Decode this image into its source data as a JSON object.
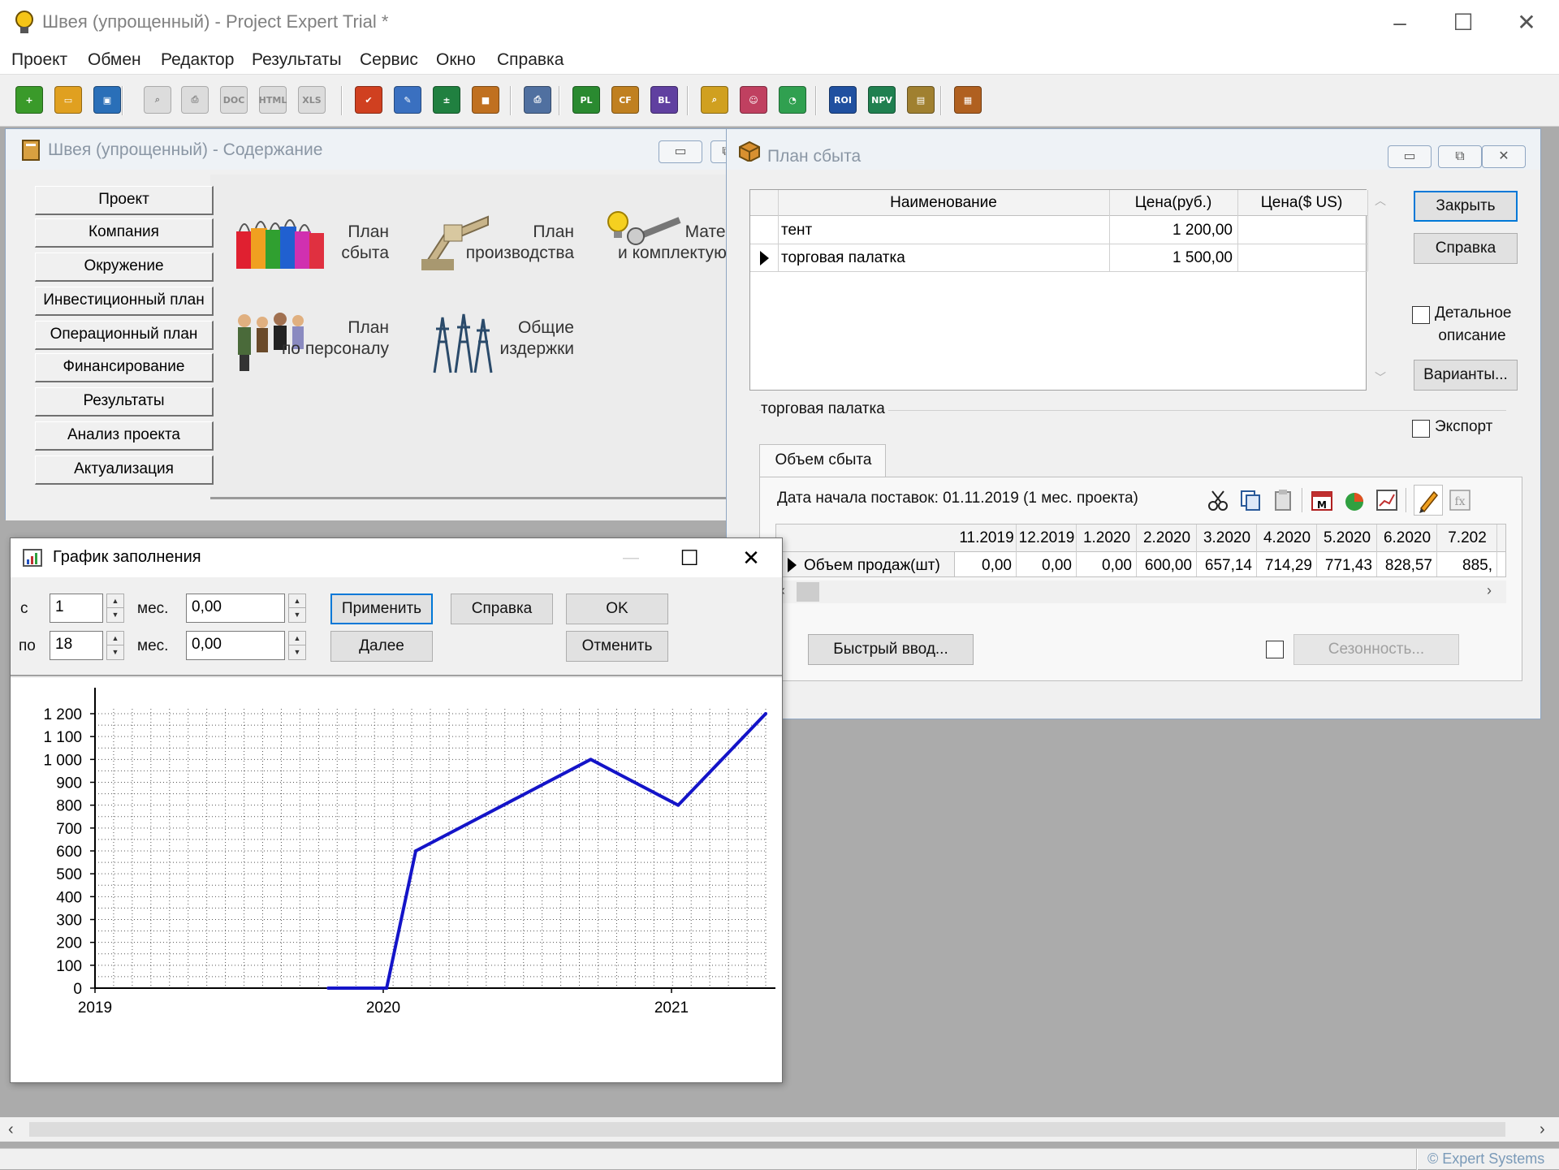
{
  "app": {
    "title": "Швея (упрощенный) - Project Expert Trial *",
    "icons": [
      "lightbulb-icon",
      "minimize-icon",
      "maximize-icon",
      "close-icon"
    ]
  },
  "menu": [
    "Проект",
    "Обмен",
    "Редактор",
    "Результаты",
    "Сервис",
    "Окно",
    "Справка"
  ],
  "toolbar": {
    "buttons": [
      {
        "name": "new-project-icon",
        "glyph": "+",
        "color": "#3a9a2a"
      },
      {
        "name": "open-folder-icon",
        "glyph": "▭",
        "color": "#e0a020"
      },
      {
        "name": "save-icon",
        "glyph": "▣",
        "color": "#2a6fb8"
      },
      {
        "name": "preview-icon",
        "glyph": "⌕",
        "color": "#c8c8c8",
        "disabled": true
      },
      {
        "name": "print-icon",
        "glyph": "⎙",
        "color": "#c8c8c8",
        "disabled": true
      },
      {
        "name": "export-doc-icon",
        "glyph": "DOC",
        "color": "#c8c8c8",
        "disabled": true
      },
      {
        "name": "export-html-icon",
        "glyph": "HTML",
        "color": "#c8c8c8",
        "disabled": true
      },
      {
        "name": "export-xls-icon",
        "glyph": "XLS",
        "color": "#c8c8c8",
        "disabled": true
      },
      {
        "name": "check-icon",
        "glyph": "✔",
        "color": "#d04020"
      },
      {
        "name": "edit-icon",
        "glyph": "✎",
        "color": "#3a70c0"
      },
      {
        "name": "calculator-icon",
        "glyph": "±",
        "color": "#208040"
      },
      {
        "name": "package-icon",
        "glyph": "■",
        "color": "#c07020"
      },
      {
        "name": "print-reports-icon",
        "glyph": "⎙",
        "color": "#5070a0"
      },
      {
        "name": "pl-report-icon",
        "glyph": "PL",
        "color": "#2a8a30"
      },
      {
        "name": "cf-report-icon",
        "glyph": "CF",
        "color": "#c08020"
      },
      {
        "name": "balance-report-icon",
        "glyph": "BL",
        "color": "#6040a0"
      },
      {
        "name": "analysis-icon",
        "glyph": "⌕",
        "color": "#d0a020"
      },
      {
        "name": "person-icon",
        "glyph": "☺",
        "color": "#c04060"
      },
      {
        "name": "chart-pie-icon",
        "glyph": "◔",
        "color": "#30a050"
      },
      {
        "name": "roi-icon",
        "glyph": "ROI",
        "color": "#2050a0"
      },
      {
        "name": "npv-icon",
        "glyph": "NPV",
        "color": "#208050"
      },
      {
        "name": "clipboard-icon",
        "glyph": "▤",
        "color": "#a08030"
      },
      {
        "name": "table-icon",
        "glyph": "▦",
        "color": "#b06020"
      }
    ]
  },
  "contents_window": {
    "title": "Швея (упрощенный) - Содержание",
    "nav": [
      "Проект",
      "Компания",
      "Окружение",
      "Инвестиционный план",
      "Операционный план",
      "Финансирование",
      "Результаты",
      "Анализ проекта",
      "Актуализация"
    ],
    "tiles": {
      "sales_plan": [
        "План",
        "сбыта"
      ],
      "production_plan": [
        "План",
        "производства"
      ],
      "materials": [
        "Матери",
        "и комплектую"
      ],
      "staff_plan": [
        "План",
        "по персоналу"
      ],
      "overheads": [
        "Общие",
        "издержки"
      ]
    }
  },
  "sales_window": {
    "title": "План сбыта",
    "table": {
      "headers": [
        "Наименование",
        "Цена(руб.)",
        "Цена($ US)"
      ],
      "rows": [
        {
          "name": "тент",
          "price_rub": "1 200,00",
          "price_usd": ""
        },
        {
          "name": "торговая палатка",
          "price_rub": "1 500,00",
          "price_usd": ""
        }
      ]
    },
    "buttons": {
      "close": "Закрыть",
      "help": "Справка",
      "variants": "Варианты..."
    },
    "detail_checkbox": "Детальное описание",
    "detail_line1": "Детальное",
    "detail_line2": "описание",
    "export_checkbox": "Экспорт",
    "group_label": "торговая палатка",
    "tab": "Объем сбыта",
    "start_date": "Дата начала поставок:  01.11.2019 (1 мес. проекта)",
    "periods": [
      "11.2019",
      "12.2019",
      "1.2020",
      "2.2020",
      "3.2020",
      "4.2020",
      "5.2020",
      "6.2020",
      "7.202"
    ],
    "volume_row_label": "Объем продаж(шт)",
    "volume_values": [
      "0,00",
      "0,00",
      "0,00",
      "600,00",
      "657,14",
      "714,29",
      "771,43",
      "828,57",
      "885,"
    ],
    "quick_input": "Быстрый ввод...",
    "seasonality": "Сезонность..."
  },
  "fill_dialog": {
    "title": "График заполнения",
    "from_label": "с",
    "to_label": "по",
    "from_month": "1",
    "to_month": "18",
    "month_unit": "мес.",
    "from_value": "0,00",
    "to_value": "0,00",
    "buttons": {
      "apply": "Применить",
      "help": "Справка",
      "ok": "OK",
      "next": "Далее",
      "cancel": "Отменить"
    }
  },
  "chart_data": {
    "type": "line",
    "title": "",
    "xlabel": "",
    "ylabel": "",
    "x_tick_labels": [
      "2019",
      "2020",
      "2021"
    ],
    "y_ticks": [
      0,
      100,
      200,
      300,
      400,
      500,
      600,
      700,
      800,
      900,
      1000,
      1100,
      1200
    ],
    "y_tick_labels": [
      "0",
      "100",
      "200",
      "300",
      "400",
      "500",
      "600",
      "700",
      "800",
      "900",
      "1 000",
      "1 100",
      "1 200"
    ],
    "ylim": [
      0,
      1200
    ],
    "xlim_months": [
      1,
      24
    ],
    "grid": true,
    "series": [
      {
        "color": "#1414c8",
        "x_month": [
          9,
          11,
          12,
          18,
          21,
          24
        ],
        "values": [
          0,
          0,
          600,
          1000,
          800,
          1200
        ]
      }
    ]
  },
  "footer": {
    "copyright": "© Expert Systems"
  }
}
